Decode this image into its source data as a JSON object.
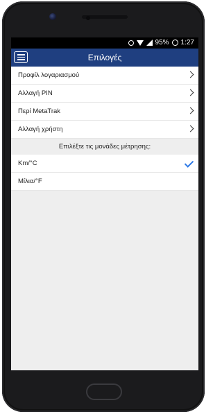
{
  "status_bar": {
    "battery": "95%",
    "time": "1:27",
    "icons": [
      "alarm-icon",
      "wifi-icon",
      "signal-icon",
      "battery-icon"
    ]
  },
  "toolbar": {
    "title": "Επιλογές",
    "menu_icon": "hamburger-icon",
    "color": "#1f3f80"
  },
  "menu": {
    "items": [
      {
        "label": "Προφίλ λογαριασμού"
      },
      {
        "label": "Αλλαγή PIN"
      },
      {
        "label": "Περί MetaTrak"
      },
      {
        "label": "Αλλαγή χρήστη"
      }
    ]
  },
  "units": {
    "header": "Επιλέξτε τις μονάδες μέτρησης:",
    "options": [
      {
        "label": "Km/°C",
        "selected": true
      },
      {
        "label": "Μίλια/°F",
        "selected": false
      }
    ],
    "check_color": "#2f7ae6"
  }
}
